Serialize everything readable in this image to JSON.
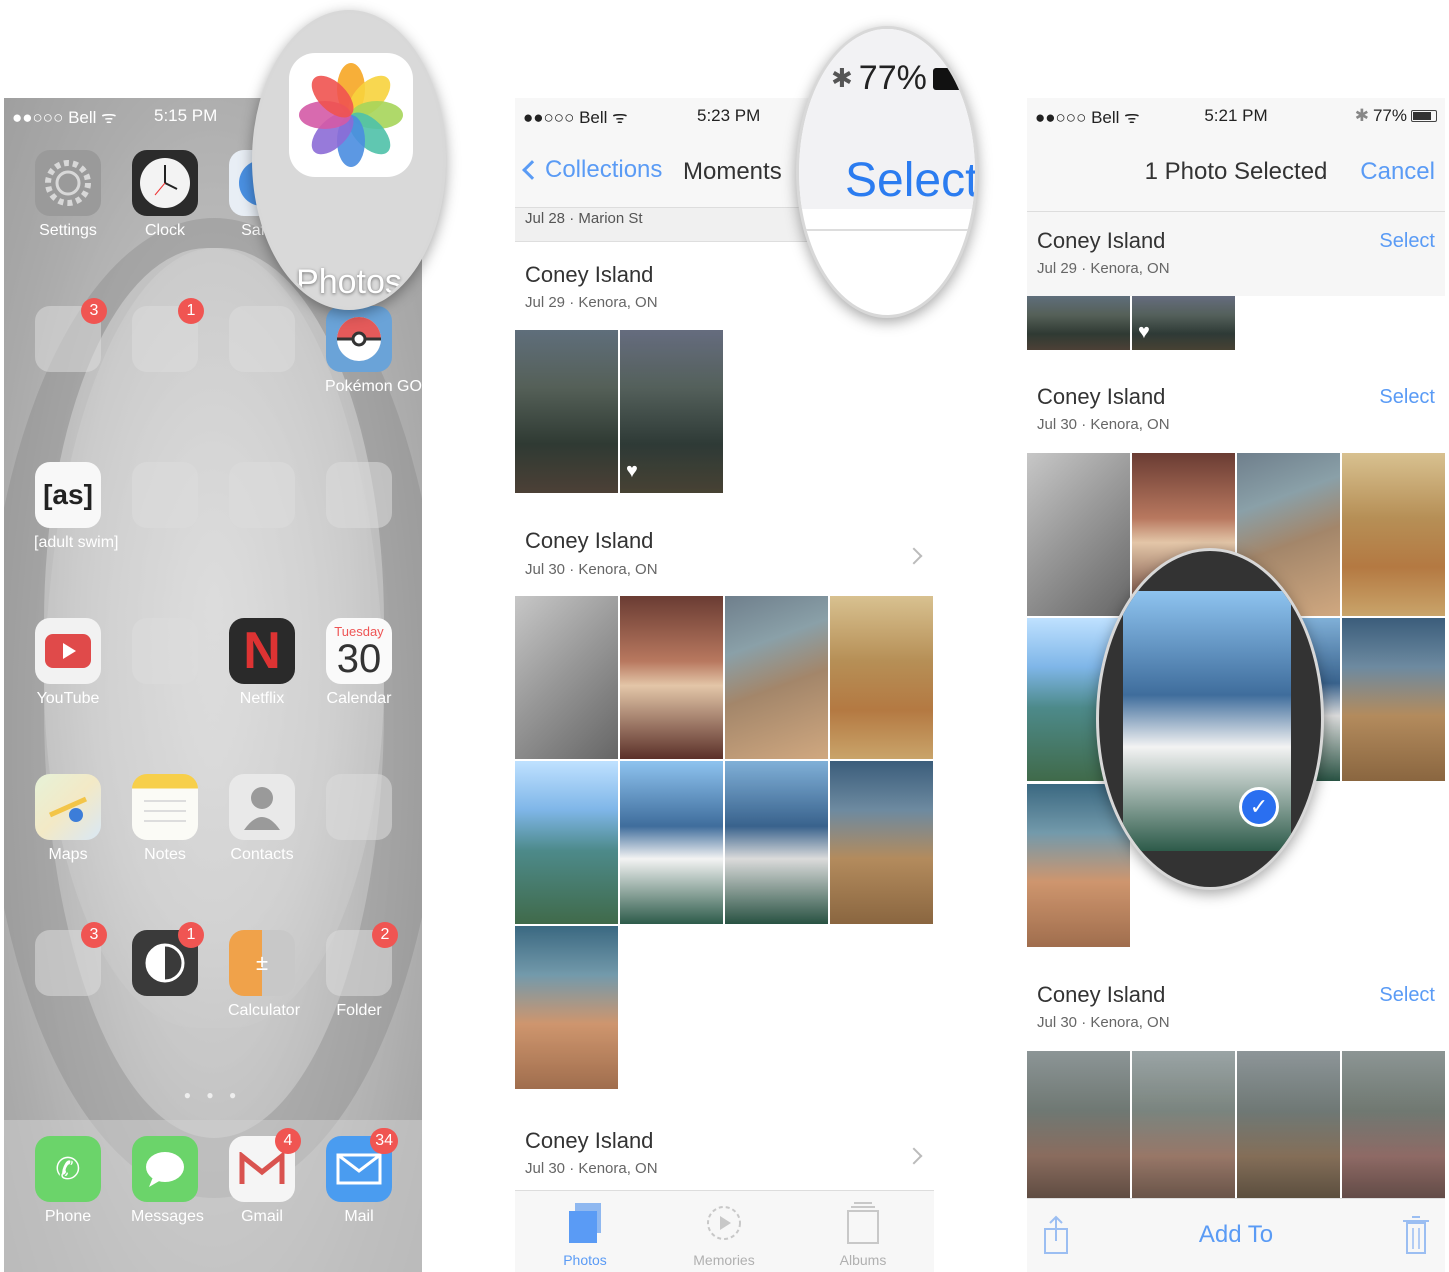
{
  "panel1": {
    "status": {
      "carrier": "●●○○○ Bell ᯤ",
      "time": "5:15 PM"
    },
    "magnifier": {
      "app_label": "Photos"
    },
    "apps": [
      {
        "label": "Settings",
        "badge": ""
      },
      {
        "label": "Clock",
        "badge": ""
      },
      {
        "label": "Safari",
        "badge": ""
      },
      {
        "label": "",
        "badge": "3"
      },
      {
        "label": "",
        "badge": "1"
      },
      {
        "label": "",
        "badge": ""
      },
      {
        "label": "Pokémon GO",
        "badge": ""
      },
      {
        "label": "[adult swim]",
        "badge": ""
      },
      {
        "label": "",
        "badge": ""
      },
      {
        "label": "",
        "badge": ""
      },
      {
        "label": "",
        "badge": ""
      },
      {
        "label": "YouTube",
        "badge": ""
      },
      {
        "label": "",
        "badge": ""
      },
      {
        "label": "Netflix",
        "badge": ""
      },
      {
        "label": "Calendar",
        "badge": ""
      },
      {
        "label": "Maps",
        "badge": ""
      },
      {
        "label": "Notes",
        "badge": ""
      },
      {
        "label": "Contacts",
        "badge": ""
      },
      {
        "label": "",
        "badge": ""
      },
      {
        "label": "",
        "badge": "3"
      },
      {
        "label": "",
        "badge": "1"
      },
      {
        "label": "Calculator",
        "badge": ""
      },
      {
        "label": "Folder",
        "badge": "2"
      }
    ],
    "calendar": {
      "day": "Tuesday",
      "date": "30"
    },
    "as_icon": "[as]",
    "dock": [
      {
        "label": "Phone",
        "badge": ""
      },
      {
        "label": "Messages",
        "badge": ""
      },
      {
        "label": "Gmail",
        "badge": "4"
      },
      {
        "label": "Mail",
        "badge": "34"
      }
    ]
  },
  "panel2": {
    "status": {
      "carrier": "●●○○○ Bell ᯤ",
      "time": "5:23 PM"
    },
    "nav": {
      "back_label": "Collections",
      "title": "Moments"
    },
    "magnifier": {
      "battery": "77%",
      "select_label": "Select"
    },
    "prev_section": "Jul 28 · Marion St",
    "sections": [
      {
        "title": "Coney Island",
        "subtitle": "Jul 29 · Kenora, ON"
      },
      {
        "title": "Coney Island",
        "subtitle": "Jul 30 · Kenora, ON"
      },
      {
        "title": "Coney Island",
        "subtitle": "Jul 30 · Kenora, ON"
      }
    ],
    "tabs": [
      {
        "label": "Photos"
      },
      {
        "label": "Memories"
      },
      {
        "label": "Albums"
      }
    ]
  },
  "panel3": {
    "status": {
      "carrier": "●●○○○ Bell ᯤ",
      "time": "5:21 PM",
      "battery": "77%"
    },
    "nav": {
      "title": "1 Photo Selected",
      "cancel_label": "Cancel"
    },
    "sections": [
      {
        "title": "Coney Island",
        "subtitle": "Jul 29 · Kenora, ON",
        "select_label": "Select"
      },
      {
        "title": "Coney Island",
        "subtitle": "Jul 30 · Kenora, ON",
        "select_label": "Select"
      },
      {
        "title": "Coney Island",
        "subtitle": "Jul 30 · Kenora, ON",
        "select_label": "Select"
      }
    ],
    "toolbar": {
      "add_to_label": "Add To"
    },
    "check_glyph": "✓"
  }
}
